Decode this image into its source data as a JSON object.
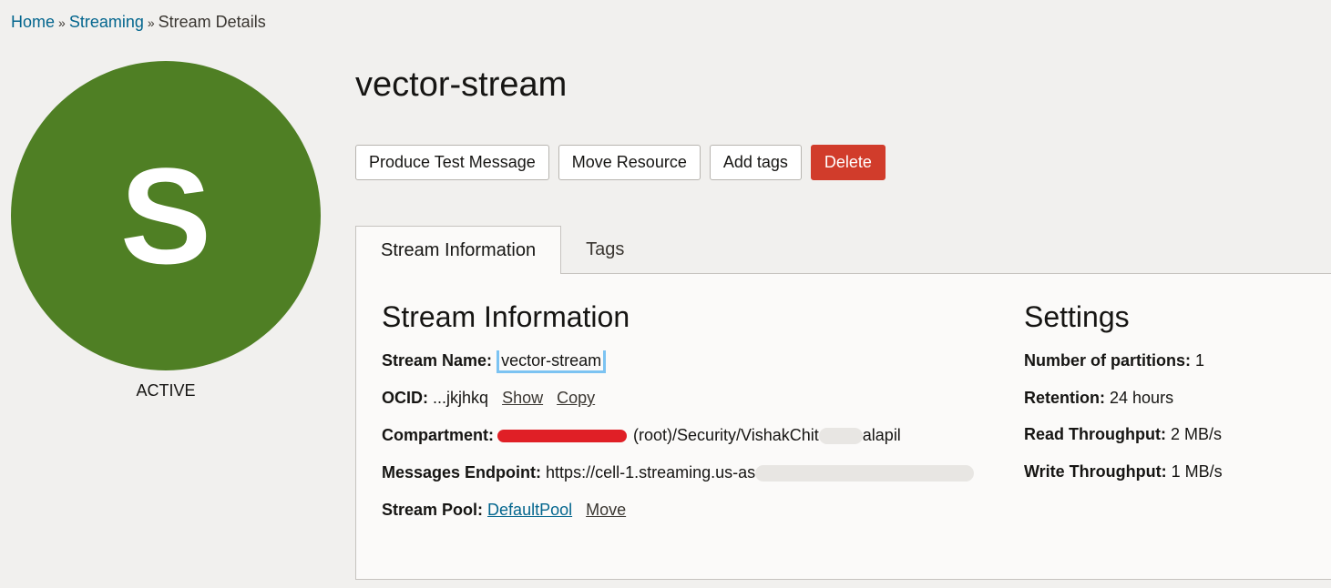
{
  "breadcrumb": {
    "home": "Home",
    "streaming": "Streaming",
    "current": "Stream Details",
    "separator": "»"
  },
  "avatar": {
    "letter": "S",
    "status": "ACTIVE",
    "color": "#4f7f24"
  },
  "title": "vector-stream",
  "actions": {
    "produce": "Produce Test Message",
    "move": "Move Resource",
    "tags": "Add tags",
    "delete": "Delete"
  },
  "tabs": {
    "info": "Stream Information",
    "tags": "Tags"
  },
  "stream_info": {
    "heading": "Stream Information",
    "name_label": "Stream Name:",
    "name_value": "vector-stream",
    "ocid_label": "OCID:",
    "ocid_value": "...jkjhkq",
    "ocid_show": "Show",
    "ocid_copy": "Copy",
    "compartment_label": "Compartment:",
    "compartment_value_start": "(root)/Security/VishakChit",
    "compartment_value_end": "alapil",
    "endpoint_label": "Messages Endpoint:",
    "endpoint_value": "https://cell-1.streaming.us-as",
    "pool_label": "Stream Pool:",
    "pool_value": "DefaultPool",
    "pool_move": "Move"
  },
  "settings": {
    "heading": "Settings",
    "partitions_label": "Number of partitions:",
    "partitions_value": "1",
    "retention_label": "Retention:",
    "retention_value": "24 hours",
    "read_label": "Read Throughput:",
    "read_value": "2 MB/s",
    "write_label": "Write Throughput:",
    "write_value": "1 MB/s"
  },
  "colors": {
    "link": "#04668e",
    "danger": "#d13c2b",
    "focus": "#7cc3f2"
  }
}
